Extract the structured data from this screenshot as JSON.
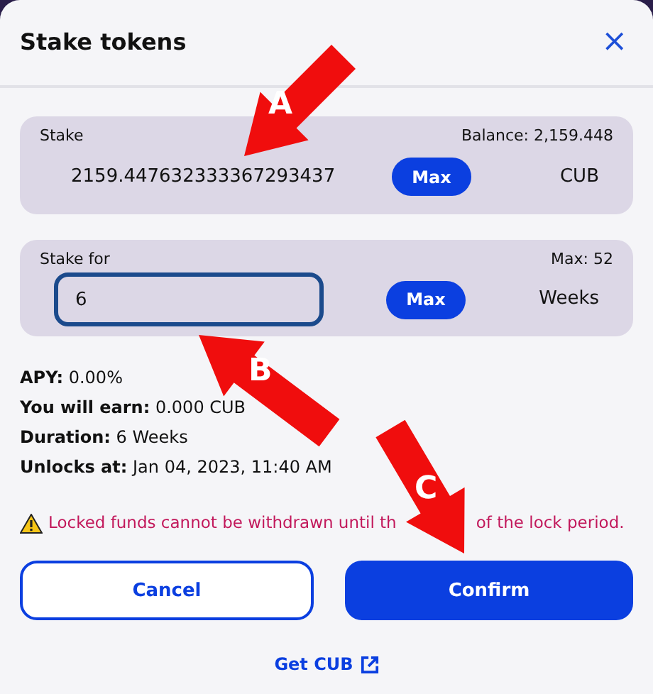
{
  "dialog": {
    "title": "Stake tokens",
    "close": "×"
  },
  "stake": {
    "label": "Stake",
    "balance": "Balance: 2,159.448",
    "value": "2159.447632333367293437",
    "max_button": "Max",
    "unit": "CUB"
  },
  "stake_for": {
    "label": "Stake for",
    "max": "Max: 52",
    "value": "6",
    "focused": true,
    "max_button": "Max",
    "unit": "Weeks"
  },
  "details": [
    {
      "label": "APY:",
      "value": "0.00%"
    },
    {
      "label": "You will earn:",
      "value": "0.000 CUB"
    },
    {
      "label": "Duration:",
      "value": "6 Weeks"
    },
    {
      "label": "Unlocks at:",
      "value": "Jan 04, 2023, 11:40 AM"
    }
  ],
  "warning_parts": [
    "Locked funds cannot be withdrawn until th",
    "of the lock period."
  ],
  "buttons": [
    {
      "label": "Cancel",
      "kind": "secondary"
    },
    {
      "label": "Confirm",
      "kind": "primary"
    }
  ],
  "link": "Get CUB",
  "annotations": [
    {
      "label": "A"
    },
    {
      "label": "B"
    },
    {
      "label": "C"
    }
  ]
}
